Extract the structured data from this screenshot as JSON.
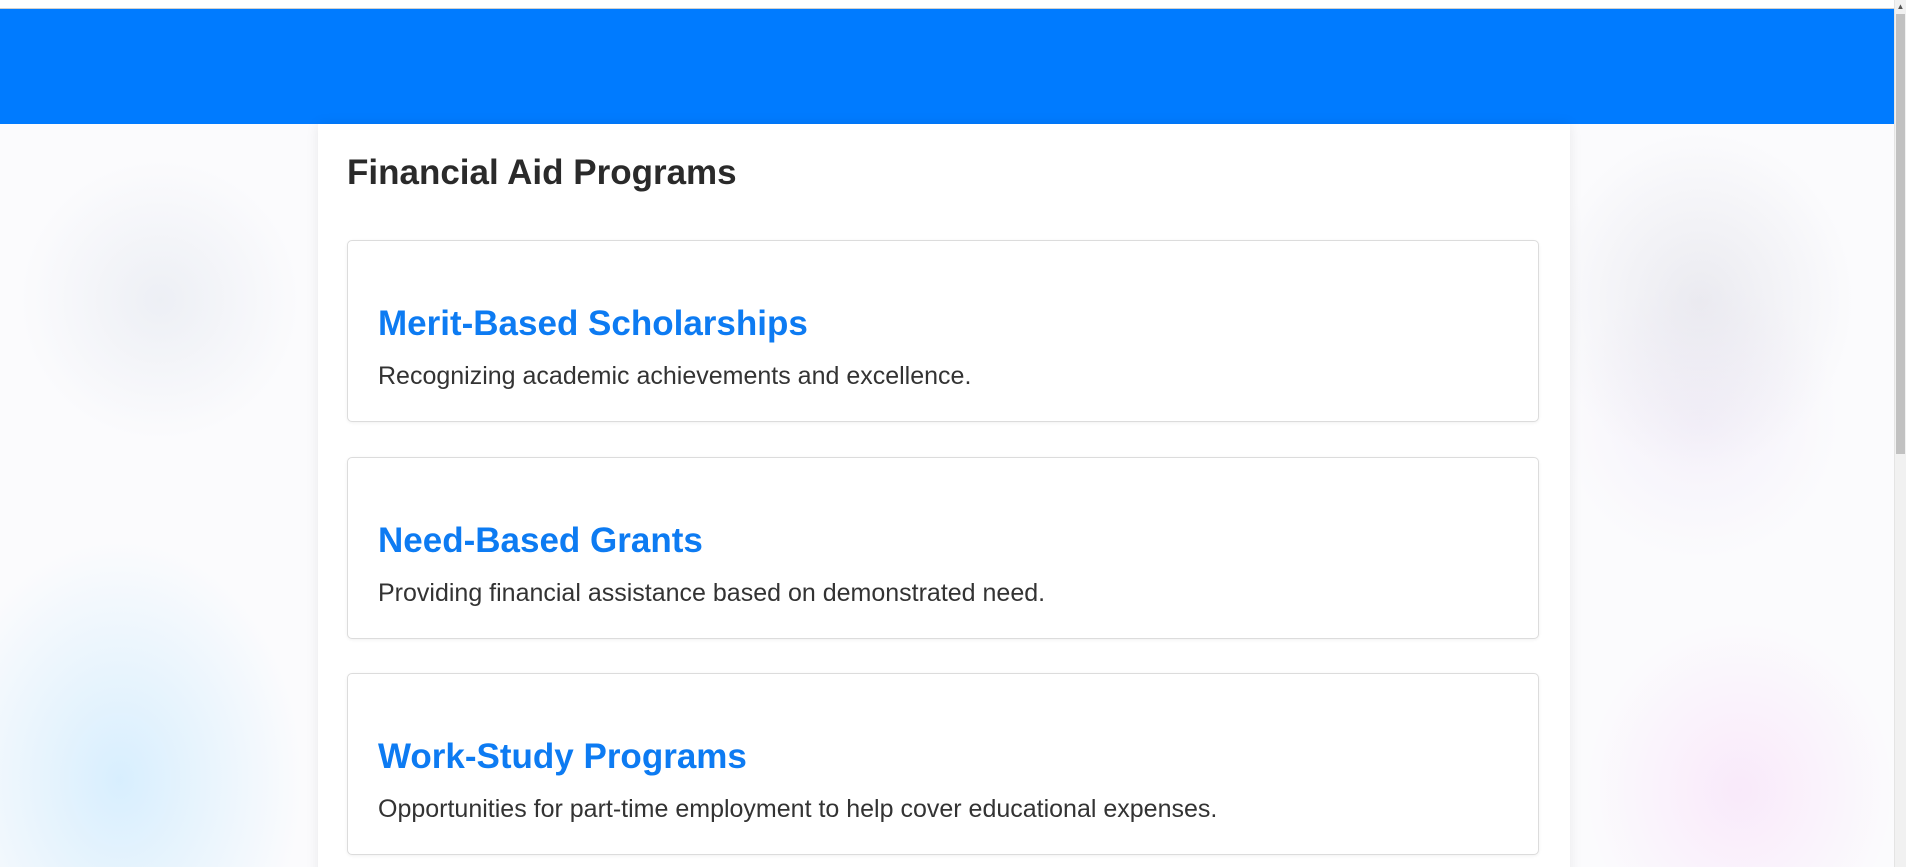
{
  "main": {
    "title": "Financial Aid Programs",
    "programs": [
      {
        "title": "Merit-Based Scholarships",
        "description": "Recognizing academic achievements and excellence."
      },
      {
        "title": "Need-Based Grants",
        "description": "Providing financial assistance based on demonstrated need."
      },
      {
        "title": "Work-Study Programs",
        "description": "Opportunities for part-time employment to help cover educational expenses."
      }
    ]
  },
  "colors": {
    "header": "#007bff",
    "link": "#0d7bf2",
    "heading": "#2a2a2a",
    "text": "#333333"
  },
  "icons": {
    "scroll_up": "chevron-up-icon"
  }
}
